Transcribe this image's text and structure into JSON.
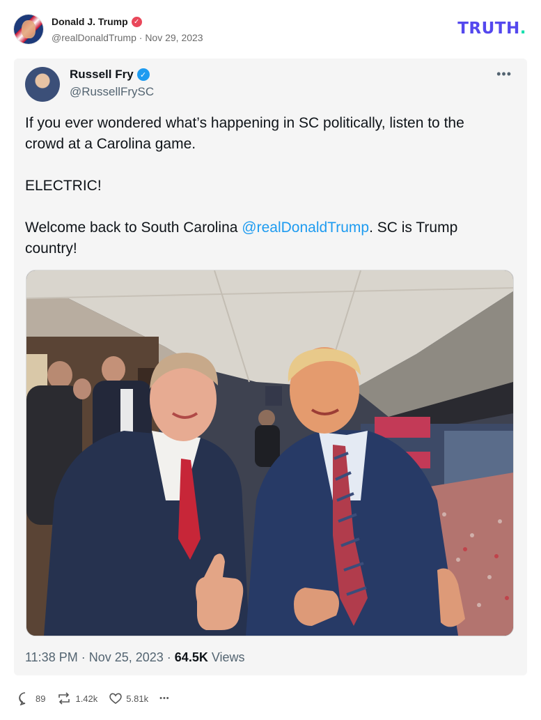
{
  "post": {
    "author_name": "Donald J. Trump",
    "author_handle": "@realDonaldTrump",
    "date": "Nov 29, 2023",
    "separator": " · "
  },
  "brand": {
    "logo_text": "TRUTH",
    "logo_dot": ".",
    "colors": {
      "primary": "#5448ee",
      "accent": "#17e0ae"
    }
  },
  "embedded_tweet": {
    "author_name": "Russell Fry",
    "author_handle": "@RussellFrySC",
    "text_line1": "If you ever wondered what’s happening in SC politically, listen to the crowd at a Carolina game.",
    "text_line2": "ELECTRIC!",
    "text_line3_before": "Welcome back to South Carolina ",
    "mention": "@realDonaldTrump",
    "text_line3_after": ". SC is Trump country!",
    "time": "11:38 PM",
    "date": "Nov 25, 2023",
    "views_count": "64.5K",
    "views_label": "Views",
    "dot": " · "
  },
  "actions": {
    "replies": "89",
    "retruths": "1.42k",
    "likes": "5.81k",
    "more": "•••"
  },
  "icons": [
    "verified-badge-icon",
    "more-icon",
    "reply-icon",
    "retruth-icon",
    "like-icon",
    "ellipsis-icon"
  ]
}
